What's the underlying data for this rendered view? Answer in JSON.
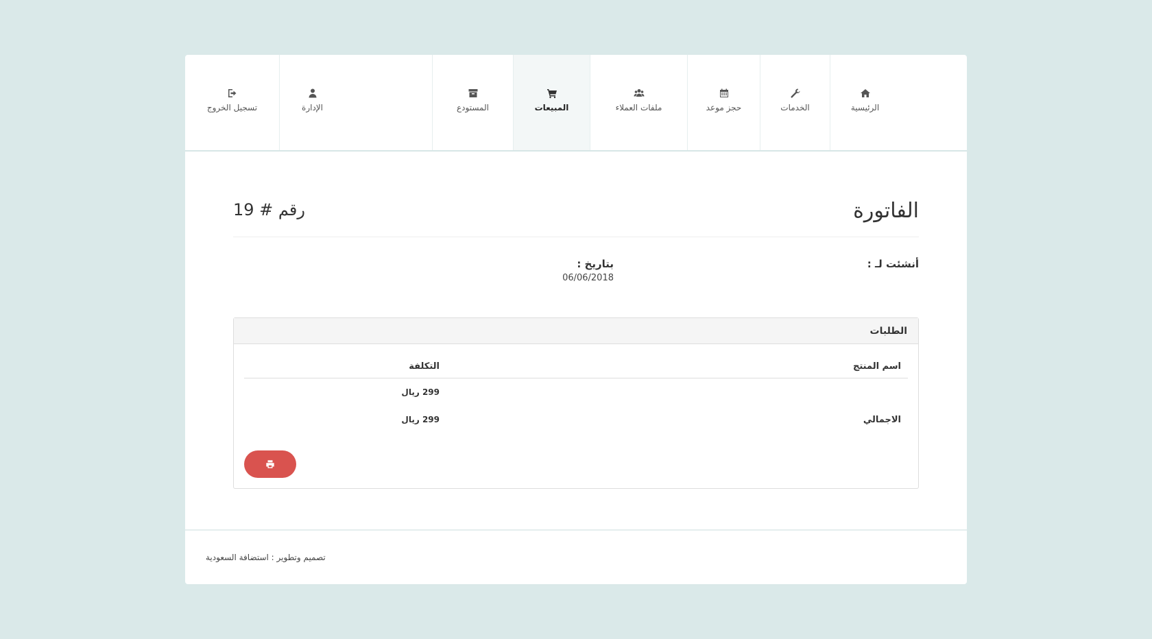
{
  "nav": {
    "items": [
      {
        "label": "الرئيسية",
        "icon": "home-icon"
      },
      {
        "label": "الخدمات",
        "icon": "wrench-icon"
      },
      {
        "label": "حجز موعد",
        "icon": "calendar-icon"
      },
      {
        "label": "ملفات العملاء",
        "icon": "users-icon"
      },
      {
        "label": "المبيعات",
        "icon": "cart-icon",
        "active": true
      },
      {
        "label": "المستودع",
        "icon": "archive-icon"
      },
      {
        "label": "الإدارة",
        "icon": "user-icon"
      },
      {
        "label": "تسجيل الخروج",
        "icon": "sign-out-icon"
      }
    ]
  },
  "invoice": {
    "title": "الفاتورة",
    "number": "رقم # 19",
    "created_by_label": "أنشئت لـ :",
    "date_label": "بتاريخ :",
    "date_value": "06/06/2018"
  },
  "orders": {
    "title": "الطلبات",
    "columns": {
      "name": "اسم المنتج",
      "cost": "التكلفة"
    },
    "rows": [
      {
        "name": "",
        "cost": "299 ريال"
      }
    ],
    "total": {
      "label": "الاجمالي",
      "cost": "299 ريال"
    },
    "print_icon": "print-icon"
  },
  "footer": {
    "text": "تصميم وتطوير : استضافة السعودية"
  },
  "colors": {
    "background": "#dae9e9",
    "print_button": "#d9534f",
    "active_nav": "#f3f7f7"
  }
}
